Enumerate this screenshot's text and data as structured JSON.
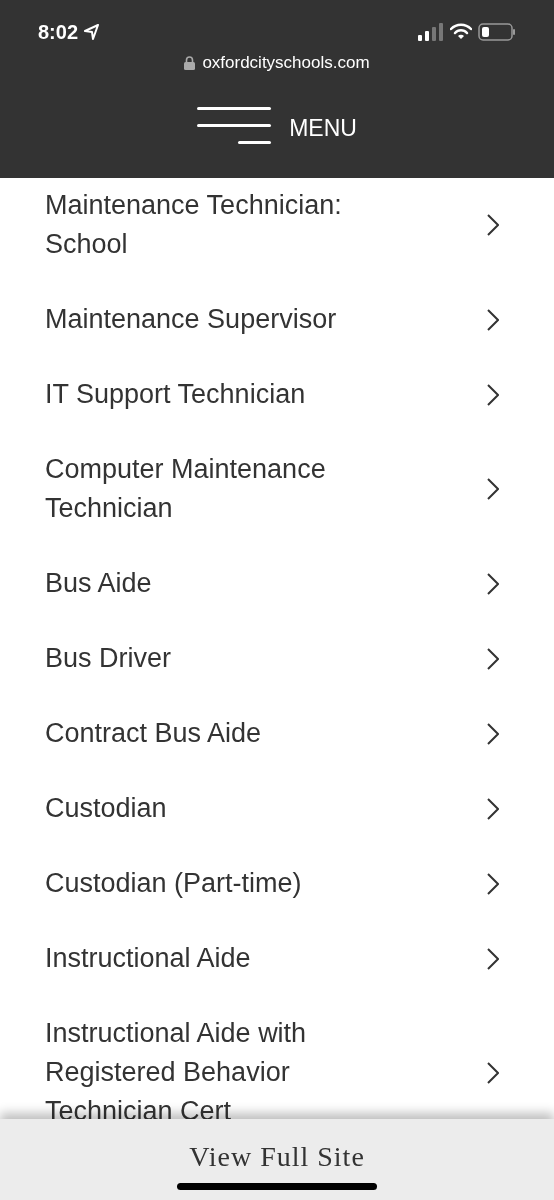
{
  "status_bar": {
    "time": "8:02"
  },
  "address_bar": {
    "url": "oxfordcityschools.com"
  },
  "header": {
    "menu_label": "MENU"
  },
  "job_list": [
    {
      "title": "Maintenance Technician:\nSchool"
    },
    {
      "title": "Maintenance Supervisor"
    },
    {
      "title": "IT Support Technician"
    },
    {
      "title": "Computer Maintenance\nTechnician"
    },
    {
      "title": "Bus Aide"
    },
    {
      "title": "Bus Driver"
    },
    {
      "title": "Contract Bus Aide"
    },
    {
      "title": "Custodian"
    },
    {
      "title": "Custodian (Part-time)"
    },
    {
      "title": "Instructional Aide"
    },
    {
      "title": "Instructional Aide with\nRegistered Behavior\nTechnician Cert"
    }
  ],
  "footer": {
    "link": "View Full Site"
  }
}
